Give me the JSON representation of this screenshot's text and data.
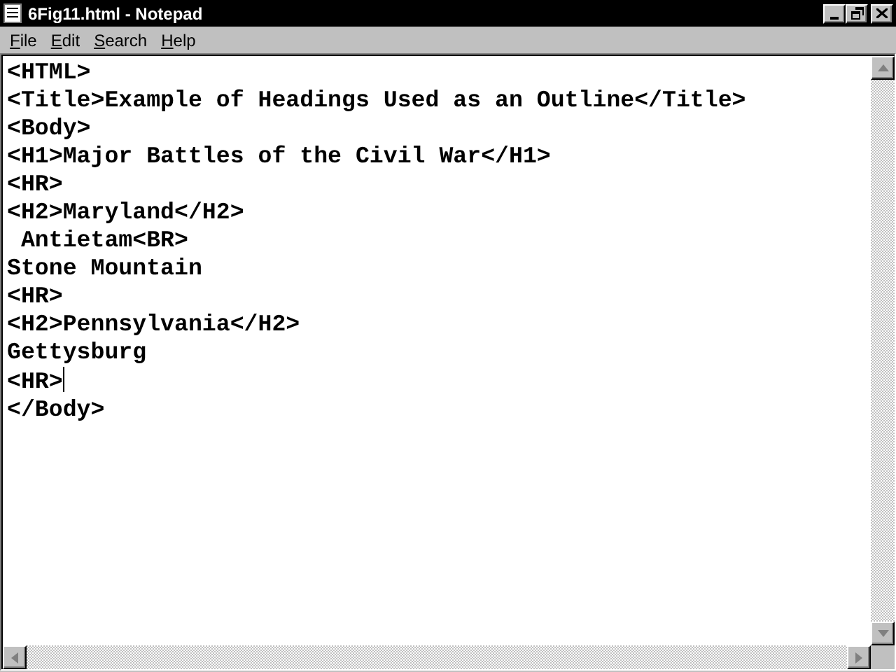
{
  "window": {
    "title": "6Fig11.html - Notepad"
  },
  "menu": [
    "File",
    "Edit",
    "Search",
    "Help"
  ],
  "editor": {
    "lines": [
      {
        "text": "<HTML>",
        "caret": false
      },
      {
        "text": "<Title>Example of Headings Used as an Outline</Title>",
        "caret": false
      },
      {
        "text": "<Body>",
        "caret": false
      },
      {
        "text": "<H1>Major Battles of the Civil War</H1>",
        "caret": false
      },
      {
        "text": "<HR>",
        "caret": false
      },
      {
        "text": "<H2>Maryland</H2>",
        "caret": false
      },
      {
        "text": " Antietam<BR>",
        "caret": false
      },
      {
        "text": "Stone Mountain",
        "caret": false
      },
      {
        "text": "<HR>",
        "caret": false
      },
      {
        "text": "<H2>Pennsylvania</H2>",
        "caret": false
      },
      {
        "text": "Gettysburg",
        "caret": false
      },
      {
        "text": "<HR>",
        "caret": true
      },
      {
        "text": "</Body>",
        "caret": false
      }
    ]
  }
}
